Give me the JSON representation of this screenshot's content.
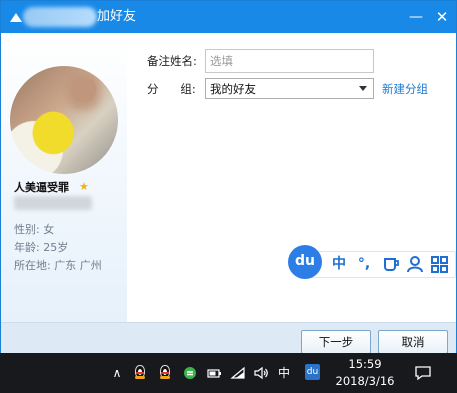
{
  "window": {
    "title_suffix": "加好友",
    "minimize_glyph": "—",
    "close_glyph": "✕"
  },
  "profile": {
    "nickname": "人美逼受罪",
    "gender": "性别: 女",
    "age": "年龄: 25岁",
    "location": "所在地: 广东  广州"
  },
  "form": {
    "remark_label": "备注姓名:",
    "remark_placeholder": "选填",
    "remark_value": "",
    "group_label": "分      组:",
    "group_selected": "我的好友",
    "new_group_link": "新建分组"
  },
  "ime": {
    "logo": "du",
    "mode": "中",
    "punct": "°,",
    "icons": [
      "cup-icon",
      "user-icon",
      "grid-icon"
    ]
  },
  "buttons": {
    "next": "下一步",
    "cancel": "取消"
  },
  "taskbar": {
    "up_arrow": "∧",
    "lang": "中",
    "du": "du",
    "time": "15:59",
    "date": "2018/3/16"
  },
  "colors": {
    "title_bar": "#1989e8",
    "link": "#1d7ad1",
    "footer": "#ddeaf6",
    "taskbar": "#18191c"
  }
}
